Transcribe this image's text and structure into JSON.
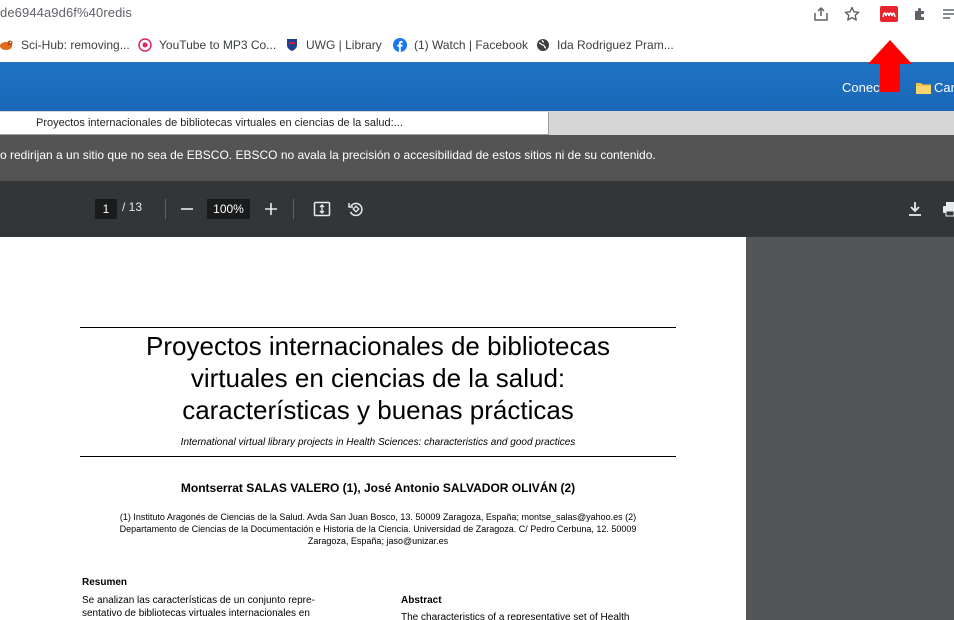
{
  "browser": {
    "url_fragment": "de6944a9d6f%40redis",
    "bookmarks": [
      {
        "label": "Sci-Hub: removing...",
        "icon": "raven-icon"
      },
      {
        "label": "YouTube to MP3 Co...",
        "icon": "target-icon"
      },
      {
        "label": "UWG | Library",
        "icon": "shield-crest-icon"
      },
      {
        "label": "(1) Watch | Facebook",
        "icon": "facebook-icon"
      },
      {
        "label": "Ida Rodriguez Pram...",
        "icon": "globe-icon"
      }
    ]
  },
  "ebsco": {
    "header_links": [
      "Conectar",
      "Car"
    ],
    "doc_tab_label": "Proyectos internacionales de bibliotecas virtuales en ciencias de la salud:...",
    "disclaimer": "o redirijan a un sitio que no sea de EBSCO. EBSCO no avala la precisión o accesibilidad de estos sitios ni de su contenido."
  },
  "pdf_toolbar": {
    "current_page": "1",
    "page_total": "/ 13",
    "zoom": "100%"
  },
  "paper": {
    "title_lines": [
      "Proyectos internacionales de bibliotecas",
      "virtuales en ciencias de la salud:",
      "características y buenas prácticas"
    ],
    "subtitle": "International virtual library projects in Health Sciences: characteristics and good practices",
    "authors": "Montserrat SALAS VALERO (1), José Antonio SALVADOR OLIVÁN (2)",
    "affiliation_lines": [
      "(1) Instituto Aragonés de Ciencias de la Salud. Avda San Juan Bosco, 13. 50009 Zaragoza, España; montse_salas@yahoo.es (2)",
      "Departamento de Ciencias de la Documentación e Historia de la Ciencia. Universidad de Zaragoza. C/ Pedro Cerbuna, 12. 50009",
      "Zaragoza, España; jaso@unizar.es"
    ],
    "resumen_heading": "Resumen",
    "resumen_lines": [
      "Se analizan las características de un conjunto repre-",
      "sentativo de bibliotecas virtuales internacionales en"
    ],
    "abstract_heading": "Abstract",
    "abstract_lines": [
      "The characteristics of a representative set of Health"
    ]
  },
  "colors": {
    "ebsco_blue": "#1f73c5",
    "pdf_toolbar": "#323639",
    "pdf_background": "#525659",
    "annotation_red": "#ff0000",
    "extension_red": "#e8242c"
  }
}
